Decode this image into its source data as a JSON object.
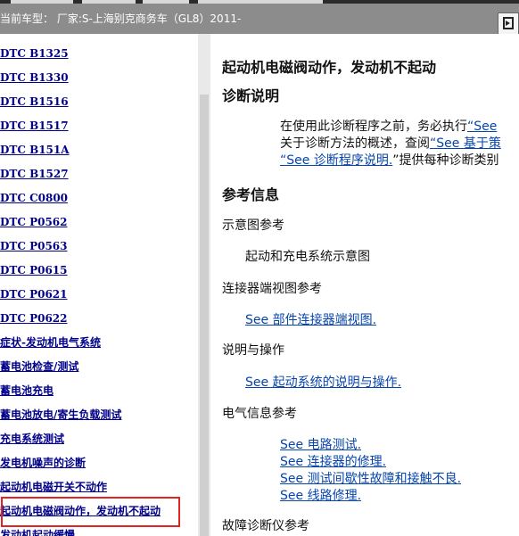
{
  "header": {
    "vehicle_label": "当前车型： 厂家:S-上海别克商务车（GL8）2011-"
  },
  "left_nav": {
    "items": [
      {
        "label": "DTC B1325"
      },
      {
        "label": "DTC B1330"
      },
      {
        "label": "DTC B1516"
      },
      {
        "label": "DTC B1517"
      },
      {
        "label": "DTC B151A"
      },
      {
        "label": "DTC B1527"
      },
      {
        "label": "DTC C0800"
      },
      {
        "label": "DTC P0562"
      },
      {
        "label": "DTC P0563"
      },
      {
        "label": "DTC P0615"
      },
      {
        "label": "DTC P0621"
      },
      {
        "label": "DTC P0622"
      },
      {
        "label": "症状-发动机电气系统"
      },
      {
        "label": "蓄电池检查/测试"
      },
      {
        "label": "蓄电池充电"
      },
      {
        "label": "蓄电池放电/寄生负载测试"
      },
      {
        "label": "充电系统测试"
      },
      {
        "label": "发电机噪声的诊断"
      },
      {
        "label": "起动机电磁开关不动作"
      },
      {
        "label": "起动机电磁阀动作，发动机不起动"
      },
      {
        "label": "发动机起动缓慢"
      }
    ]
  },
  "content": {
    "title": "起动机电磁阀动作，发动机不起动",
    "diag_heading": "诊断说明",
    "diag_line1_text": "在使用此诊断程序之前，务必执行",
    "diag_line1_link": "“See",
    "diag_line2_text": "关于诊断方法的概述，查阅",
    "diag_line2_link": "“See 基于策",
    "diag_line3_link": "“See 诊断程序说明.",
    "diag_line3_text": "”提供每种诊断类别",
    "ref_heading": "参考信息",
    "schematic_heading": "示意图参考",
    "schematic_text": "起动和充电系统示意图",
    "connector_heading": "连接器端视图参考",
    "connector_link": "See 部件连接器端视图.",
    "desc_heading": "说明与操作",
    "desc_link": "See 起动系统的说明与操作.",
    "elec_heading": "电气信息参考",
    "elec_links": [
      "See 电路测试.",
      "See 连接器的修理.",
      "See 测试间歇性故障和接触不良.",
      "See 线路修理."
    ],
    "scan_heading": "故障诊断仪参考"
  }
}
